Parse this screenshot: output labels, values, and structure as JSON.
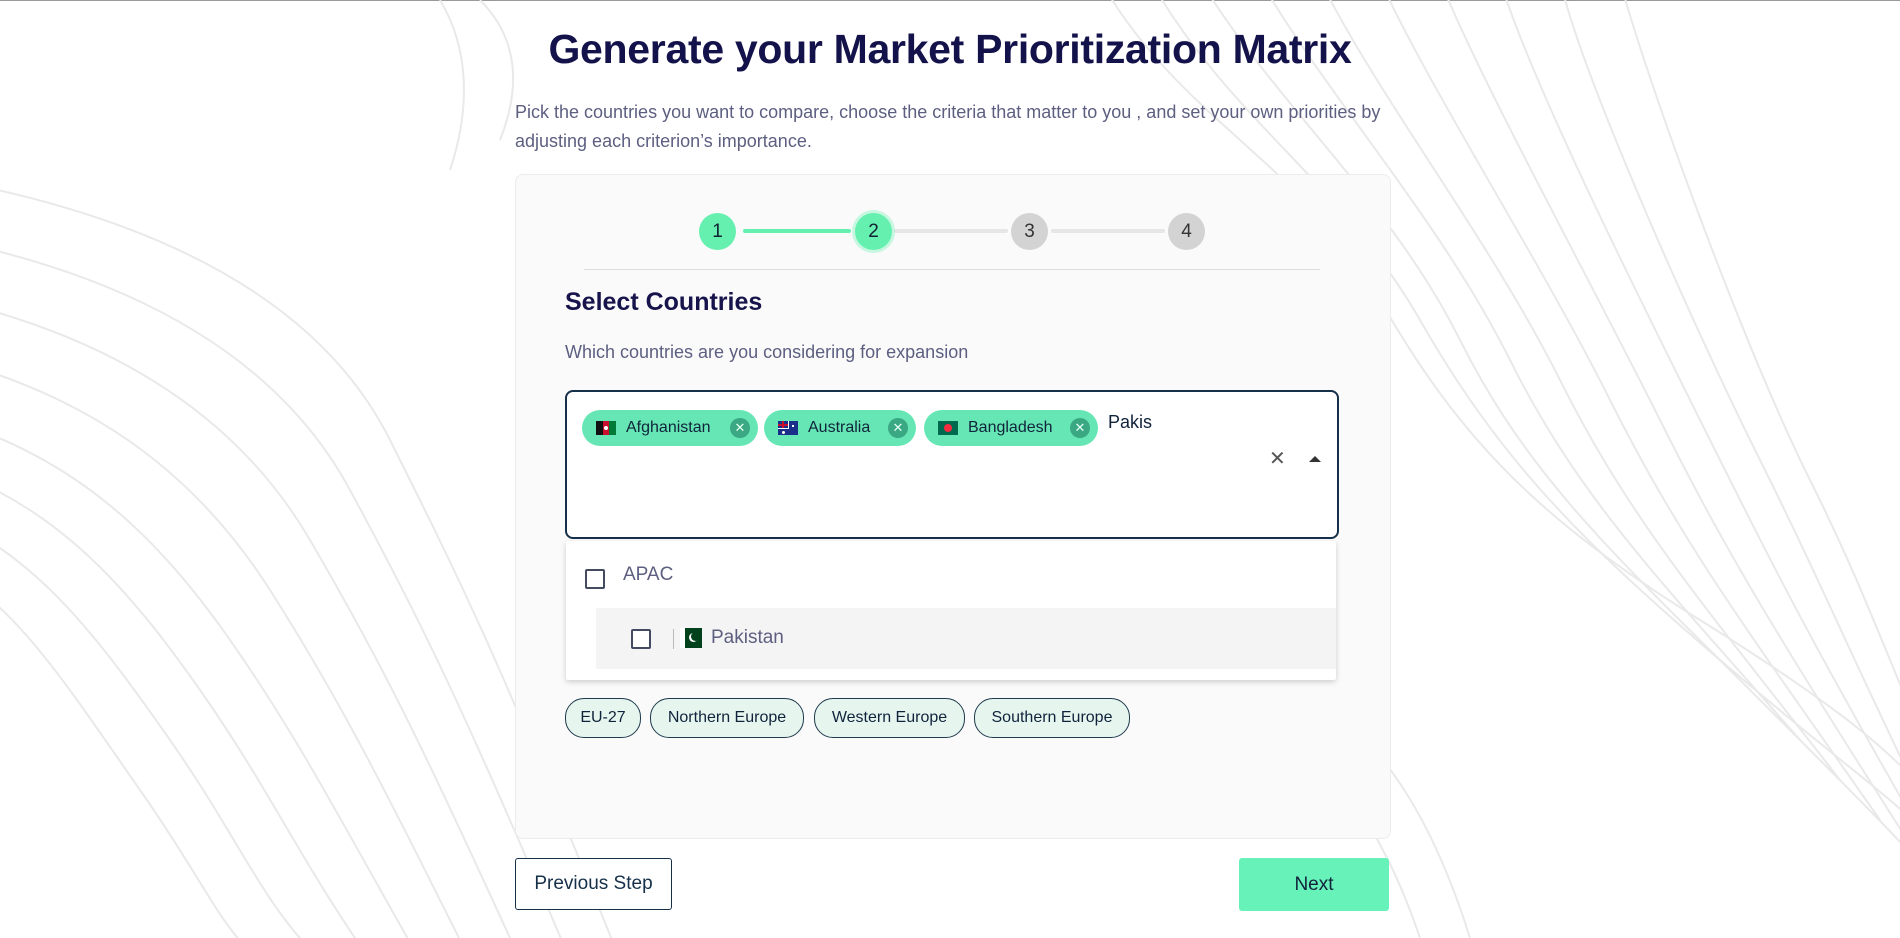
{
  "page": {
    "title": "Generate your Market Prioritization Matrix",
    "description": "Pick the countries you want to compare, choose the criteria that matter to you , and set your own priorities by adjusting each criterion’s importance."
  },
  "stepper": {
    "steps": [
      {
        "label": "1",
        "state": "done"
      },
      {
        "label": "2",
        "state": "active"
      },
      {
        "label": "3",
        "state": "todo"
      },
      {
        "label": "4",
        "state": "todo"
      }
    ]
  },
  "section": {
    "title": "Select Countries",
    "subtitle": "Which countries are you considering for expansion"
  },
  "country_select": {
    "selected": [
      {
        "label": "Afghanistan",
        "flag": "afghanistan-flag-icon"
      },
      {
        "label": "Australia",
        "flag": "australia-flag-icon"
      },
      {
        "label": "Bangladesh",
        "flag": "bangladesh-flag-icon"
      }
    ],
    "search_value": "Pakis",
    "clear_icon": "close-icon",
    "toggle_icon": "caret-up-icon",
    "dropdown": {
      "group_label": "APAC",
      "options": [
        {
          "label": "Pakistan",
          "flag": "pakistan-flag-icon"
        }
      ]
    }
  },
  "regions": [
    "EU-27",
    "Northern Europe",
    "Western Europe",
    "Southern Europe"
  ],
  "footer": {
    "prev_label": "Previous Step",
    "next_label": "Next"
  },
  "colors": {
    "accent": "#66f0b0",
    "title": "#14124a",
    "text_muted": "#5c5f80",
    "border_dark": "#16304a"
  }
}
